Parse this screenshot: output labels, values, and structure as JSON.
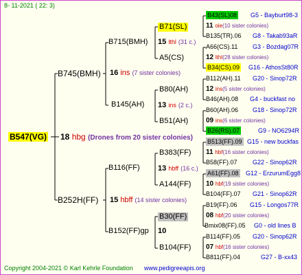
{
  "date": "8- 11-2021 ( 22: 3)",
  "root": {
    "name": "B547(VG)",
    "bg": "#ffff00"
  },
  "root_drone": {
    "num": "18",
    "code": "hbg",
    "text": "(Drones from 20 sister colonies)"
  },
  "gen1": [
    {
      "name": "B745(BMH)",
      "num": "16",
      "code": "ins",
      "note": "(7 sister colonies)"
    },
    {
      "name": "B252H(FF)",
      "num": "15",
      "code": "hbff",
      "note": "(14 sister colonies)"
    }
  ],
  "gen2": [
    {
      "name": "B715(BMH)",
      "num": "15",
      "code": "lthl",
      "note": "(31 c.)"
    },
    {
      "name": "B145(AH)",
      "num": "13",
      "code": "ins",
      "note": "(2 c.)"
    },
    {
      "name": "B116(FF)",
      "num": "13",
      "code": "hbff",
      "note": "(16 c.)"
    },
    {
      "name": "B152(FF)gp",
      "num": "10",
      "code": "",
      "note": ""
    }
  ],
  "gen3": [
    {
      "name": "B71(SL)",
      "num": "11",
      "code": "oie",
      "note": "(10 sister colonies)",
      "bg": "#ffff00"
    },
    {
      "name": "A5(CS)",
      "num": "12",
      "code": "lthl",
      "note": "(28 sister colonies)",
      "bg": ""
    },
    {
      "name": "B80(AH)",
      "num": "12",
      "code": "ins",
      "note": "(5 sister colonies)",
      "bg": ""
    },
    {
      "name": "B51(AH)",
      "num": "09",
      "code": "ins",
      "note": "(6 sister colonies)",
      "bg": ""
    },
    {
      "name": "B383(FF)",
      "num": "11",
      "code": "hbf",
      "note": "(16 sister colonies)",
      "bg": ""
    },
    {
      "name": "A144(FF)",
      "num": "10",
      "code": "hbf",
      "note": "(19 sister colonies)",
      "bg": ""
    },
    {
      "name": "B30(FF)",
      "num": "08",
      "code": "hbf",
      "note": "(20 sister colonies)",
      "bg": "#c0c0c0"
    },
    {
      "name": "B104(FF)",
      "num": "07",
      "code": "hbf",
      "note": "(16 sister colonies)",
      "bg": ""
    }
  ],
  "gen4": [
    {
      "name": "B43(SL)08",
      "ref": "G5 - Bayburt98-3",
      "bg": "#00cc00"
    },
    {
      "name": "B135(TR).06",
      "ref": "G8 - Takab93aR",
      "bg": ""
    },
    {
      "name": "A66(CS).11",
      "ref": "G3 - Bozdag07R",
      "bg": ""
    },
    {
      "name": "B34(CS).09",
      "ref": "G16 - AthosSt80R",
      "bg": "#ffff00"
    },
    {
      "name": "B112(AH).11",
      "ref": "G20 - Sinop72R",
      "bg": ""
    },
    {
      "name": "B46(AH).08",
      "ref": "G4 - buckfast no",
      "bg": ""
    },
    {
      "name": "B60(AH).06",
      "ref": "G18 - Sinop72R",
      "bg": ""
    },
    {
      "name": "B26(RS).07",
      "ref": "G9 - NO6294R",
      "bg": "#00cc00"
    },
    {
      "name": "B513(FF).09",
      "ref": "G15 - new buckfas",
      "bg": "#c0c0c0"
    },
    {
      "name": "B58(FF).07",
      "ref": "G22 - Sinop62R",
      "bg": ""
    },
    {
      "name": "A61(FF).08",
      "ref": "G12 - ErzurumEgg8",
      "bg": "#c0c0c0"
    },
    {
      "name": "B104(FF).07",
      "ref": "G21 - Sinop62R",
      "bg": ""
    },
    {
      "name": "B19(FF).06",
      "ref": "G15 - Longos77R",
      "bg": ""
    },
    {
      "name": "Bmix08(FF).05",
      "ref": "G0 - old lines B",
      "bg": ""
    },
    {
      "name": "B114(FF).05",
      "ref": "G20 - Sinop62R",
      "bg": ""
    },
    {
      "name": "B811(FF).04",
      "ref": "G27 - B-xx43",
      "bg": ""
    }
  ],
  "footer_left": "Copyright 2004-2021 © Karl Kehrle Foundation",
  "footer_right": "www.pedigreeapis.org"
}
